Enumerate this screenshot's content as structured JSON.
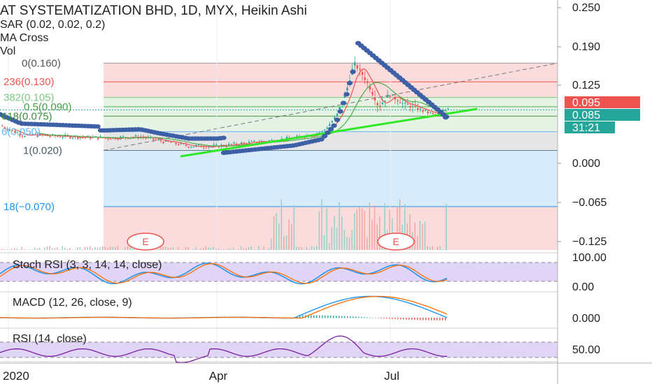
{
  "header": {
    "title": "AT SYSTEMATIZATION BHD, 1D, MYX, Heikin Ashi",
    "indicators": [
      "SAR (0.02, 0.02, 0.2)",
      "MA Cross",
      "Vol"
    ]
  },
  "colors": {
    "up": "#26a69a",
    "down": "#ef5350",
    "sar": "#3d5fa6",
    "trendline": "#2fe827",
    "ma_fast": "#ef5350",
    "ma_slow": "#4caf50",
    "osc_main": "#2196f3",
    "osc_signal": "#ff6d00",
    "rsi_line": "#7b1fa2",
    "osc_band": "#e1d5f7",
    "fib_red": "#fbdcdc",
    "fib_green": "#e5f3e4",
    "fib_blue": "#d8ebfb",
    "fib_gray": "#e6e6e6"
  },
  "chart_data": [
    {
      "type": "candlestick",
      "title": "AT SYSTEMATIZATION BHD, 1D, MYX, Heikin Ashi",
      "ylim": [
        -0.15,
        0.26
      ],
      "y_ticks": [
        "0.250",
        "0.190",
        "0.125",
        "0.000",
        "−0.065",
        "−0.125"
      ],
      "price_tags": [
        {
          "label": "0.095",
          "value": 0.095,
          "color": "#ef5350"
        },
        {
          "label": "0.085",
          "value": 0.085,
          "color": "#26a69a"
        },
        {
          "label": "31:21",
          "color": "#26a69a"
        }
      ],
      "fib_levels": [
        {
          "label": "0(0.160)",
          "value": 0.16
        },
        {
          "label": "236(0.130)",
          "value": 0.13
        },
        {
          "label": "382(0.105)",
          "value": 0.105
        },
        {
          "label": "0.5(0.090)",
          "value": 0.09
        },
        {
          "label": "618(0.075)",
          "value": 0.075
        },
        {
          "label": "6(0.050)",
          "value": 0.05
        },
        {
          "label": "1(0.020)",
          "value": 0.02
        },
        {
          "label": "18(−0.070)",
          "value": -0.07
        }
      ],
      "events": [
        "E",
        "E"
      ],
      "x_ticks": [
        "2020",
        "Apr",
        "Jul"
      ]
    },
    {
      "type": "line",
      "title": "Stoch RSI (3, 3, 14, 14, close)",
      "ylim": [
        0,
        100
      ],
      "y_ticks": [
        "100.00",
        "0.00"
      ],
      "bands": [
        80,
        20
      ]
    },
    {
      "type": "line",
      "title": "MACD (12, 26, close, 9)",
      "y_ticks": [
        "0.000"
      ]
    },
    {
      "type": "line",
      "title": "RSI (14, close)",
      "ylim": [
        0,
        100
      ],
      "y_ticks": [
        "50.00"
      ],
      "bands": [
        70,
        30
      ]
    }
  ]
}
